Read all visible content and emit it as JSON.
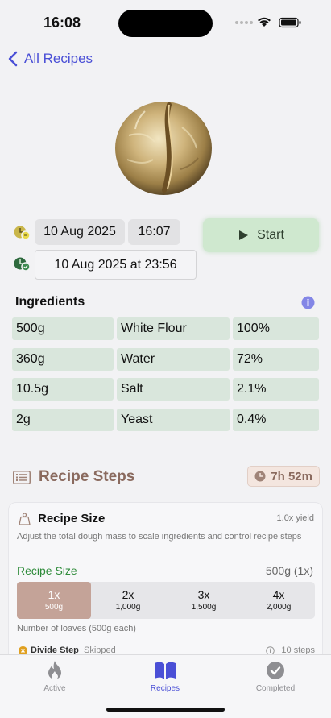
{
  "status": {
    "time": "16:08"
  },
  "nav": {
    "back_label": "All Recipes"
  },
  "schedule": {
    "start_date": "10 Aug 2025",
    "start_time": "16:07",
    "end_datetime": "10 Aug 2025 at 23:56",
    "start_button": "Start"
  },
  "ingredients": {
    "title": "Ingredients",
    "rows": [
      {
        "amount": "500g",
        "name": "White Flour",
        "percent": "100%"
      },
      {
        "amount": "360g",
        "name": "Water",
        "percent": "72%"
      },
      {
        "amount": "10.5g",
        "name": "Salt",
        "percent": "2.1%"
      },
      {
        "amount": "2g",
        "name": "Yeast",
        "percent": "0.4%"
      }
    ]
  },
  "steps": {
    "title": "Recipe Steps",
    "duration": "7h 52m",
    "card": {
      "title": "Recipe Size",
      "yield": "1.0x yield",
      "description": "Adjust the total dough mass to scale ingredients and control recipe steps",
      "size_label": "Recipe Size",
      "size_value": "500g (1x)",
      "options": [
        {
          "label": "1x",
          "mass": "500g"
        },
        {
          "label": "2x",
          "mass": "1,000g"
        },
        {
          "label": "3x",
          "mass": "1,500g"
        },
        {
          "label": "4x",
          "mass": "2,000g"
        }
      ],
      "selected_option": "1x",
      "loaves_note": "Number of loaves (500g each)",
      "divide_label": "Divide Step",
      "divide_status": "Skipped",
      "step_count": "10 steps"
    }
  },
  "tabs": [
    {
      "label": "Active",
      "icon": "flame-icon"
    },
    {
      "label": "Recipes",
      "icon": "book-icon"
    },
    {
      "label": "Completed",
      "icon": "checkmark-circle-icon"
    }
  ],
  "colors": {
    "accent": "#4a4fd6",
    "start_button": "#cfe8cf",
    "ingredient_cell": "#d9e6dc",
    "steps_title": "#8a6a5e",
    "selected_segment": "#c4a398",
    "recipe_size_green": "#2e8b3a"
  }
}
